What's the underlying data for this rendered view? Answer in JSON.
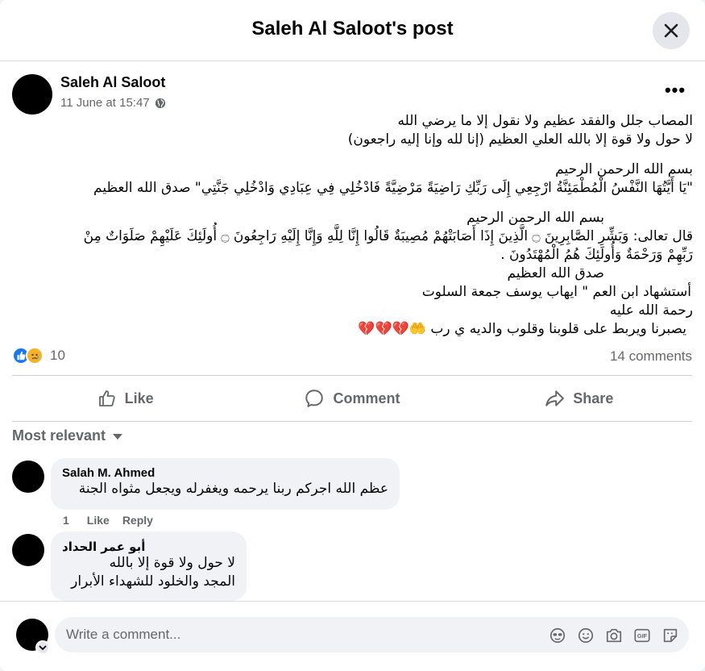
{
  "header": {
    "title": "Saleh Al Saloot's post"
  },
  "post": {
    "author": "Saleh Al Saloot",
    "timestamp": "11 June at 15:47",
    "privacy_icon": "globe-icon",
    "lines": [
      "المصاب جلل والفقد عظيم ولا نقول إلا ما يرضي الله",
      "لا حول ولا قوة إلا بالله العلي العظيم (إنا لله وإنا إليه راجعون)",
      "بسم الله الرحمن الرحيم",
      "\"يَا أَيَّتُهَا النَّفْسُ الْمُطْمَئِنَّةُ ارْجِعِي إِلَى رَبِّكِ رَاضِيَةً مَرْضِيَّةً فَادْخُلِي فِي عِبَادِي وَادْخُلِي جَنَّتِي\" صدق الله العظيم",
      "بسم الله الرحمن الرحيم",
      "قال تعالى: وَبَشِّرِ الصَّابِرِينَ ۝ الَّذِينَ إِذَا أَصَابَتْهُمْ مُصِيبَةٌ قَالُوا إِنَّا لِلَّهِ وَإِنَّا إِلَيْهِ رَاجِعُونَ ۝ أُولَئِكَ عَلَيْهِمْ صَلَوَاتٌ مِنْ",
      "رَبِّهِمْ وَرَحْمَةٌ وَأُولَئِكَ هُمُ الْمُهْتَدُونَ .",
      "صدق الله العظيم",
      "أستشهاد ابن العم \" ايهاب يوسف جمعة السلوت",
      "رحمة الله عليه",
      "يصبرنا ويربط على قلوبنا وقلوب والديه ي رب 🤲💔💔💔"
    ],
    "reaction_count": "10",
    "comments_count": "14 comments"
  },
  "actions": {
    "like": "Like",
    "comment": "Comment",
    "share": "Share"
  },
  "sort_label": "Most relevant",
  "comments": [
    {
      "author": "Salah M. Ahmed",
      "text": "عظم الله اجركم ربنا يرحمه ويغفرله ويجعل مثواه الجنة",
      "count": "1",
      "like": "Like",
      "reply": "Reply"
    },
    {
      "author": "أبو عمر الحداد",
      "text": "لا حول ولا قوة إلا بالله\nالمجد والخلود للشهداء الأبرار"
    }
  ],
  "composer": {
    "placeholder": "Write a comment..."
  },
  "icons": [
    "close-icon",
    "more-icon",
    "like-reaction-icon",
    "sad-reaction-icon",
    "thumbs-up-icon",
    "comment-icon",
    "share-icon",
    "caret-down-icon",
    "avatar-sticker-icon",
    "emoji-icon",
    "camera-icon",
    "gif-icon",
    "sticker-icon"
  ]
}
